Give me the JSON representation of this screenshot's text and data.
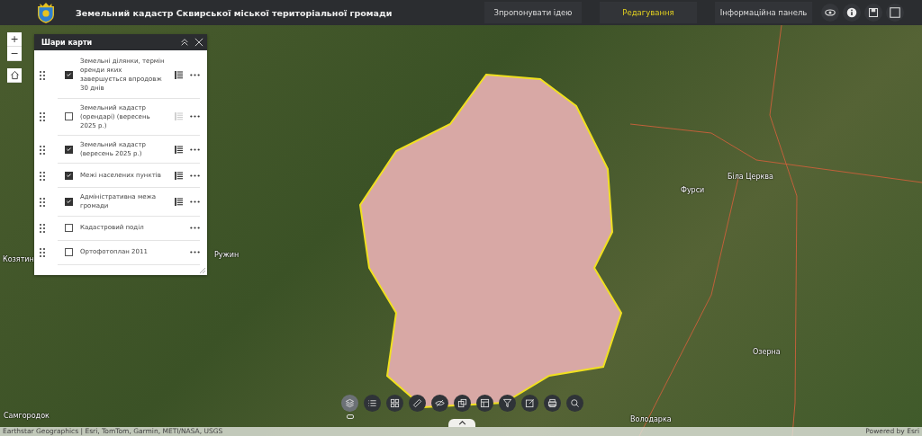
{
  "header": {
    "title": "Земельний кадастр Сквирської міської територіальної громади",
    "nav": [
      {
        "label": "Зпропонувати ідею",
        "selected": false
      },
      {
        "label": "Редагування",
        "selected": true
      },
      {
        "label": "Інформаційна панель",
        "selected": false
      }
    ]
  },
  "map_controls": {
    "zoom_in": "+",
    "zoom_out": "−"
  },
  "layers_panel": {
    "title": "Шари карти",
    "layers": [
      {
        "name": "Земельні ділянки, термін оренди яких завершується впродовж 30 днів",
        "checked": true,
        "has_legend": true,
        "legend_disabled": false
      },
      {
        "name": "Земельний кадастр (орендарі) (вересень 2025 р.)",
        "checked": false,
        "has_legend": true,
        "legend_disabled": true
      },
      {
        "name": "Земельний кадастр (вересень 2025 р.)",
        "checked": true,
        "has_legend": true,
        "legend_disabled": false
      },
      {
        "name": "Межі населених пунктів",
        "checked": true,
        "has_legend": true,
        "legend_disabled": false
      },
      {
        "name": "Адміністративна межа громади",
        "checked": true,
        "has_legend": true,
        "legend_disabled": false
      },
      {
        "name": "Кадастровий поділ",
        "checked": false,
        "has_legend": false
      },
      {
        "name": "Ортофотоплан 2011",
        "checked": false,
        "has_legend": false
      }
    ]
  },
  "place_labels": [
    "Козятин",
    "Ружин",
    "Самгородок",
    "Біла Церква",
    "Фурси",
    "Озерна",
    "Володарка"
  ],
  "toolbar": [
    {
      "selected": true
    },
    {
      "selected": false
    },
    {
      "selected": false
    },
    {
      "selected": false
    },
    {
      "selected": false
    },
    {
      "selected": false
    },
    {
      "selected": false
    },
    {
      "selected": false
    },
    {
      "selected": false
    },
    {
      "selected": false
    },
    {
      "selected": false
    }
  ],
  "attribution": "Earthstar Geographics | Esri, TomTom, Garmin, METI/NASA, USGS",
  "powered_by": "Powered by Esri"
}
